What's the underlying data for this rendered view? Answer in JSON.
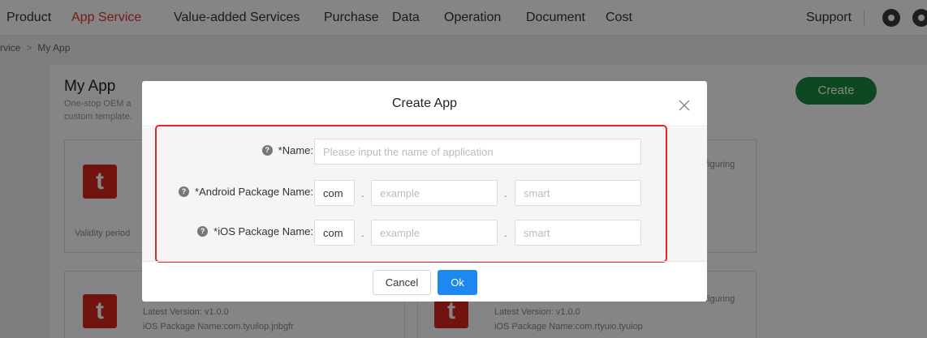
{
  "nav": {
    "items": [
      "Product",
      "App Service",
      "Value-added Services",
      "Purchase",
      "Data",
      "Operation",
      "Document",
      "Cost"
    ],
    "active_index": 1,
    "support": "Support"
  },
  "breadcrumb": {
    "parent": "rvice",
    "current": "My App"
  },
  "page": {
    "title": "My App",
    "desc_line1": "One-stop OEM a",
    "desc_line2": "custom template.",
    "create_label": "Create"
  },
  "cards": [
    {
      "validity": "Validity period",
      "side_text": "nfiguring"
    },
    {
      "version": "Latest Version: v1.0.0",
      "ios_pkg": "iOS Package Name:com.tyuilop.jnbgfr"
    },
    {
      "side_text": "nfiguring",
      "version": "Latest Version: v1.0.0",
      "ios_pkg": "iOS Package Name:com.rtyuio.tyuiop"
    }
  ],
  "modal": {
    "title": "Create App",
    "name_label": "*Name:",
    "name_placeholder": "Please input the name of application",
    "android_label": "*Android Package Name:",
    "ios_label": "*iOS Package Name:",
    "prefix_value": "com",
    "segment_placeholder": "example",
    "suffix_placeholder": "smart",
    "cancel_label": "Cancel",
    "ok_label": "Ok"
  },
  "colors": {
    "accent_red": "#e2352e",
    "create_green": "#1c8a3e",
    "ok_blue": "#1e87f0",
    "highlight_red": "#e8262a"
  }
}
